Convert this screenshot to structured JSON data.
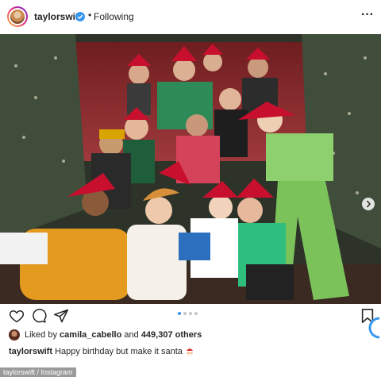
{
  "post": {
    "username": "taylorswift",
    "separator": "•",
    "follow_status": "Following",
    "more_icon": "more-options-icon"
  },
  "actions": {
    "like_icon": "heart-icon",
    "comment_icon": "comment-icon",
    "share_icon": "send-icon",
    "save_icon": "bookmark-icon",
    "carousel_total": 4,
    "carousel_active": 1
  },
  "likes": {
    "prefix": "Liked by",
    "user": "camila_cabello",
    "connector": "and",
    "count": "449,307 others"
  },
  "caption": {
    "username": "taylorswift",
    "text": "Happy birthday but make it santa"
  },
  "credit": "taylorswift / Instagram",
  "colors": {
    "accent": "#3897f0",
    "text": "#262626"
  }
}
